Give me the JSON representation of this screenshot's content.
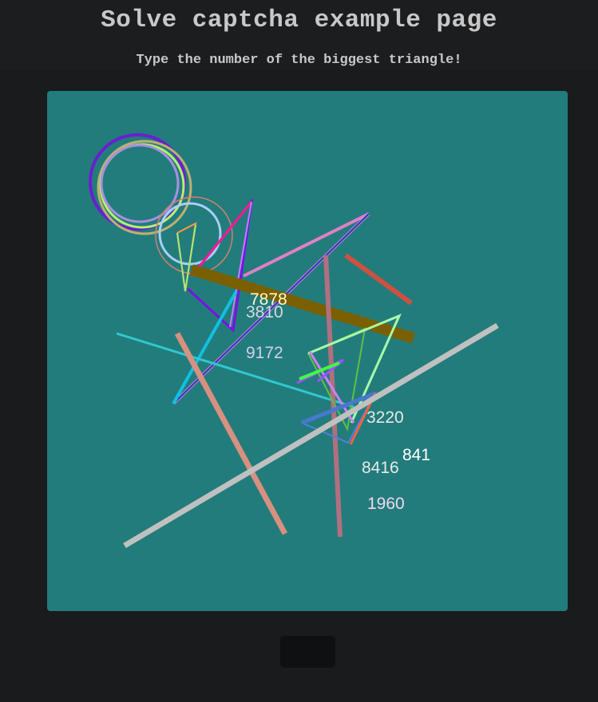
{
  "page": {
    "title": "Solve captcha example page",
    "instruction": "Type the number of the biggest triangle!"
  },
  "captcha": {
    "background_color": "#237c7c",
    "labels": [
      {
        "text": "7878",
        "color": "#fff8c8"
      },
      {
        "text": "3810",
        "color": "#d8d8e0"
      },
      {
        "text": "9172",
        "color": "#d0d0e8"
      },
      {
        "text": "3220",
        "color": "#e8e8e8"
      },
      {
        "text": "841",
        "color": "#ffffff"
      },
      {
        "text": "8416",
        "color": "#e8e8e8"
      },
      {
        "text": "1960",
        "color": "#f0d8f0"
      }
    ]
  },
  "submit_button": {
    "label": ""
  }
}
